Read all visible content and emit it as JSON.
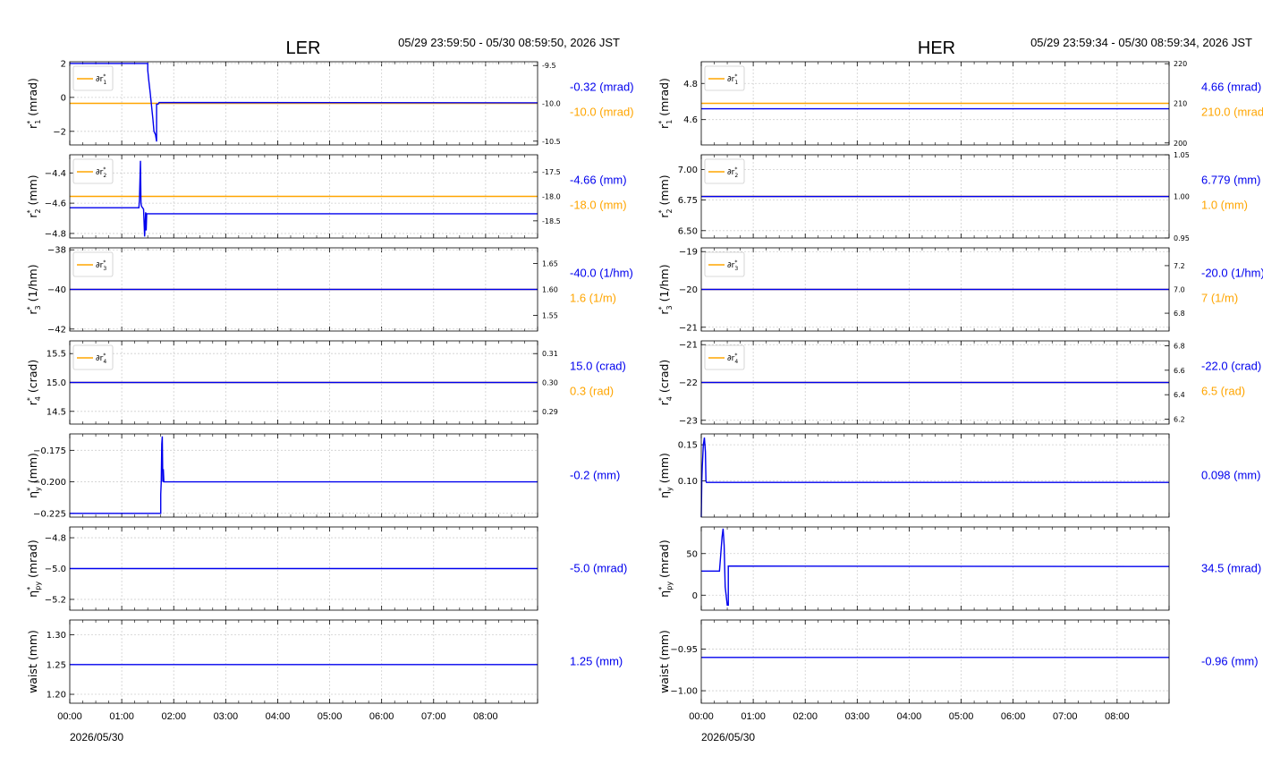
{
  "colors": {
    "blue": "#0000ee",
    "orange": "#ffa500",
    "grid": "#cfcfcf"
  },
  "columns": [
    {
      "title": "LER",
      "time_range": "05/29 23:59:50 - 05/30 08:59:50, 2026 JST",
      "date_label": "2026/05/30",
      "x_ticks": [
        "00:00",
        "01:00",
        "02:00",
        "03:00",
        "04:00",
        "05:00",
        "06:00",
        "07:00",
        "08:00"
      ]
    },
    {
      "title": "HER",
      "time_range": "05/29 23:59:34 - 05/30 08:59:34, 2026 JST",
      "date_label": "2026/05/30",
      "x_ticks": [
        "00:00",
        "01:00",
        "02:00",
        "03:00",
        "04:00",
        "05:00",
        "06:00",
        "07:00",
        "08:00"
      ]
    }
  ],
  "chart_data": [
    {
      "panel": "LER r1",
      "type": "line",
      "ylabel": "r*1 (mrad)",
      "legend": "∂r*1",
      "ylim": [
        -2.8,
        2.1
      ],
      "yticks": [
        2,
        0,
        -2
      ],
      "ytick_labels": [
        "2",
        "0",
        "−2"
      ],
      "y2lim": [
        -10.55,
        -9.45
      ],
      "y2ticks": [
        -9.5,
        -10.0,
        -10.5
      ],
      "y2tick_labels": [
        "-9.5",
        "-10.0",
        "-10.5"
      ],
      "blue": {
        "x": [
          0,
          1.5,
          1.5,
          1.52,
          1.55,
          1.58,
          1.6,
          1.62,
          1.65,
          1.67,
          1.67,
          1.7,
          1.72,
          9
        ],
        "y": [
          2,
          2,
          1.6,
          1.0,
          0.2,
          -0.7,
          -1.3,
          -2.0,
          -2.2,
          -2.6,
          -0.4,
          -0.4,
          -0.3,
          -0.32
        ]
      },
      "orange": {
        "x": [
          0,
          9
        ],
        "y": [
          -10.0,
          -10.0
        ]
      },
      "value_label": "-0.32 (mrad)",
      "value2_label": "-10.0 (mrad)"
    },
    {
      "panel": "LER r2",
      "type": "line",
      "ylabel": "r*2 (mm)",
      "legend": "∂r*2",
      "ylim": [
        -4.83,
        -4.28
      ],
      "yticks": [
        -4.4,
        -4.6,
        -4.8
      ],
      "ytick_labels": [
        "−4.4",
        "−4.6",
        "−4.8"
      ],
      "y2lim": [
        -18.85,
        -17.15
      ],
      "y2ticks": [
        -17.5,
        -18.0,
        -18.5
      ],
      "y2tick_labels": [
        "-17.5",
        "-18.0",
        "-18.5"
      ],
      "blue": {
        "x": [
          0,
          1.33,
          1.34,
          1.36,
          1.37,
          1.38,
          1.4,
          1.42,
          1.44,
          1.46,
          1.47,
          1.48,
          1.5,
          9
        ],
        "y": [
          -4.63,
          -4.63,
          -4.58,
          -4.32,
          -4.6,
          -4.62,
          -4.63,
          -4.64,
          -4.82,
          -4.66,
          -4.78,
          -4.67,
          -4.67,
          -4.67
        ]
      },
      "orange": {
        "x": [
          0,
          9
        ],
        "y": [
          -18.0,
          -18.0
        ]
      },
      "value_label": "-4.66 (mm)",
      "value2_label": "-18.0 (mm)"
    },
    {
      "panel": "LER r3",
      "type": "line",
      "ylabel": "r*3 (1/hm)",
      "legend": "∂r*3",
      "ylim": [
        -42.1,
        -37.9
      ],
      "yticks": [
        -38,
        -40,
        -42
      ],
      "ytick_labels": [
        "−38",
        "−40",
        "−42"
      ],
      "y2lim": [
        1.52,
        1.68
      ],
      "y2ticks": [
        1.65,
        1.6,
        1.55
      ],
      "y2tick_labels": [
        "1.65",
        "1.60",
        "1.55"
      ],
      "blue": {
        "x": [
          0,
          9
        ],
        "y": [
          -40.0,
          -40.0
        ]
      },
      "orange": {
        "x": [
          0,
          9
        ],
        "y": [
          1.6,
          1.6
        ]
      },
      "value_label": "-40.0 (1/hm)",
      "value2_label": "1.6 (1/m)"
    },
    {
      "panel": "LER r4",
      "type": "line",
      "ylabel": "r*4 (crad)",
      "legend": "∂r*4",
      "ylim": [
        14.28,
        15.72
      ],
      "yticks": [
        15.5,
        15.0,
        14.5
      ],
      "ytick_labels": [
        "15.5",
        "15.0",
        "14.5"
      ],
      "y2lim": [
        0.2856,
        0.3144
      ],
      "y2ticks": [
        0.31,
        0.3,
        0.29
      ],
      "y2tick_labels": [
        "0.31",
        "0.30",
        "0.29"
      ],
      "blue": {
        "x": [
          0,
          9
        ],
        "y": [
          15.0,
          15.0
        ]
      },
      "orange": {
        "x": [
          0,
          9
        ],
        "y": [
          0.3,
          0.3
        ]
      },
      "value_label": "15.0 (crad)",
      "value2_label": "0.3 (rad)"
    },
    {
      "panel": "LER eta_y",
      "type": "line",
      "ylabel": "η*y (mm)",
      "ylim": [
        -0.228,
        -0.162
      ],
      "yticks": [
        -0.175,
        -0.2,
        -0.225
      ],
      "ytick_labels": [
        "−0.175",
        "−0.200",
        "−0.225"
      ],
      "blue": {
        "x": [
          0,
          1.75,
          1.75,
          1.76,
          1.77,
          1.78,
          1.79,
          1.8,
          1.81,
          9
        ],
        "y": [
          -0.225,
          -0.225,
          -0.21,
          -0.2,
          -0.17,
          -0.164,
          -0.2,
          -0.19,
          -0.2,
          -0.2
        ]
      },
      "value_label": "-0.2 (mm)"
    },
    {
      "panel": "LER eta_py",
      "type": "line",
      "ylabel": "η*py (mrad)",
      "ylim": [
        -5.27,
        -4.73
      ],
      "yticks": [
        -4.8,
        -5.0,
        -5.2
      ],
      "ytick_labels": [
        "−4.8",
        "−5.0",
        "−5.2"
      ],
      "blue": {
        "x": [
          0,
          9
        ],
        "y": [
          -5.0,
          -5.0
        ]
      },
      "value_label": "-5.0 (mrad)"
    },
    {
      "panel": "LER waist",
      "type": "line",
      "ylabel": "waist (mm)",
      "ylim": [
        1.185,
        1.325
      ],
      "yticks": [
        1.3,
        1.25,
        1.2
      ],
      "ytick_labels": [
        "1.30",
        "1.25",
        "1.20"
      ],
      "blue": {
        "x": [
          0,
          9
        ],
        "y": [
          1.25,
          1.25
        ]
      },
      "value_label": "1.25 (mm)"
    },
    {
      "panel": "HER r1",
      "type": "line",
      "ylabel": "r*1 (mrad)",
      "legend": "∂r*1",
      "ylim": [
        4.46,
        4.92
      ],
      "yticks": [
        4.8,
        4.6
      ],
      "ytick_labels": [
        "4.8",
        "4.6"
      ],
      "y2lim": [
        199.5,
        220.5
      ],
      "y2ticks": [
        220,
        210,
        200
      ],
      "y2tick_labels": [
        "220",
        "210",
        "200"
      ],
      "blue": {
        "x": [
          0,
          9
        ],
        "y": [
          4.66,
          4.66
        ]
      },
      "orange": {
        "x": [
          0,
          9
        ],
        "y": [
          210.0,
          210.0
        ]
      },
      "value_label": "4.66 (mrad)",
      "value2_label": "210.0 (mrad)"
    },
    {
      "panel": "HER r2",
      "type": "line",
      "ylabel": "r*2 (mm)",
      "legend": "∂r*2",
      "ylim": [
        6.44,
        7.12
      ],
      "yticks": [
        7.0,
        6.75,
        6.5
      ],
      "ytick_labels": [
        "7.00",
        "6.75",
        "6.50"
      ],
      "y2lim": [
        0.95,
        1.05
      ],
      "y2ticks": [
        1.05,
        1.0,
        0.95
      ],
      "y2tick_labels": [
        "1.05",
        "1.00",
        "0.95"
      ],
      "blue": {
        "x": [
          0,
          9
        ],
        "y": [
          6.779,
          6.779
        ]
      },
      "orange": {
        "x": [
          0,
          9
        ],
        "y": [
          1.0,
          1.0
        ]
      },
      "value_label": "6.779 (mm)",
      "value2_label": "1.0 (mm)"
    },
    {
      "panel": "HER r3",
      "type": "line",
      "ylabel": "r*3 (1/hm)",
      "legend": "∂r*3",
      "ylim": [
        -21.1,
        -18.9
      ],
      "yticks": [
        -19,
        -20,
        -21
      ],
      "ytick_labels": [
        "−19",
        "−20",
        "−21"
      ],
      "y2lim": [
        6.65,
        7.35
      ],
      "y2ticks": [
        7.2,
        7.0,
        6.8
      ],
      "y2tick_labels": [
        "7.2",
        "7.0",
        "6.8"
      ],
      "blue": {
        "x": [
          0,
          9
        ],
        "y": [
          -20.0,
          -20.0
        ]
      },
      "orange": {
        "x": [
          0,
          9
        ],
        "y": [
          7.0,
          7.0
        ]
      },
      "value_label": "-20.0 (1/hm)",
      "value2_label": "7 (1/m)"
    },
    {
      "panel": "HER r4",
      "type": "line",
      "ylabel": "r*4 (crad)",
      "legend": "∂r*4",
      "ylim": [
        -23.1,
        -20.9
      ],
      "yticks": [
        -21,
        -22,
        -23
      ],
      "ytick_labels": [
        "−21",
        "−22",
        "−23"
      ],
      "y2lim": [
        6.16,
        6.84
      ],
      "y2ticks": [
        6.8,
        6.6,
        6.4,
        6.2
      ],
      "y2tick_labels": [
        "6.8",
        "6.6",
        "6.4",
        "6.2"
      ],
      "blue": {
        "x": [
          0,
          9
        ],
        "y": [
          -22.0,
          -22.0
        ]
      },
      "orange": {
        "x": [
          0,
          9
        ],
        "y": [
          6.5,
          6.5
        ]
      },
      "value_label": "-22.0 (crad)",
      "value2_label": "6.5 (rad)"
    },
    {
      "panel": "HER eta_y",
      "type": "line",
      "ylabel": "η*y (mm)",
      "ylim": [
        0.05,
        0.165
      ],
      "yticks": [
        0.15,
        0.1
      ],
      "ytick_labels": [
        "0.15",
        "0.10"
      ],
      "blue": {
        "x": [
          0,
          0.01,
          0.02,
          0.04,
          0.06,
          0.08,
          0.09,
          0.1,
          0.12,
          9
        ],
        "y": [
          0.05,
          0.1,
          0.12,
          0.15,
          0.16,
          0.14,
          0.1,
          0.098,
          0.098,
          0.098
        ]
      },
      "value_label": "0.098 (mm)"
    },
    {
      "panel": "HER eta_py",
      "type": "line",
      "ylabel": "η*py (mrad)",
      "ylim": [
        -18,
        82
      ],
      "yticks": [
        50,
        0
      ],
      "ytick_labels": [
        "50",
        "0"
      ],
      "blue": {
        "x": [
          0,
          0.35,
          0.37,
          0.4,
          0.42,
          0.44,
          0.46,
          0.5,
          0.5,
          0.52,
          0.52,
          9
        ],
        "y": [
          29,
          29,
          45,
          70,
          80,
          60,
          10,
          -12,
          -12,
          -12,
          35,
          34.5
        ]
      },
      "value_label": "34.5 (mrad)"
    },
    {
      "panel": "HER waist",
      "type": "line",
      "ylabel": "waist (mm)",
      "ylim": [
        -1.015,
        -0.915
      ],
      "yticks": [
        -0.95,
        -1.0
      ],
      "ytick_labels": [
        "−0.95",
        "−1.00"
      ],
      "blue": {
        "x": [
          0,
          9
        ],
        "y": [
          -0.96,
          -0.96
        ]
      },
      "value_label": "-0.96 (mm)"
    }
  ]
}
